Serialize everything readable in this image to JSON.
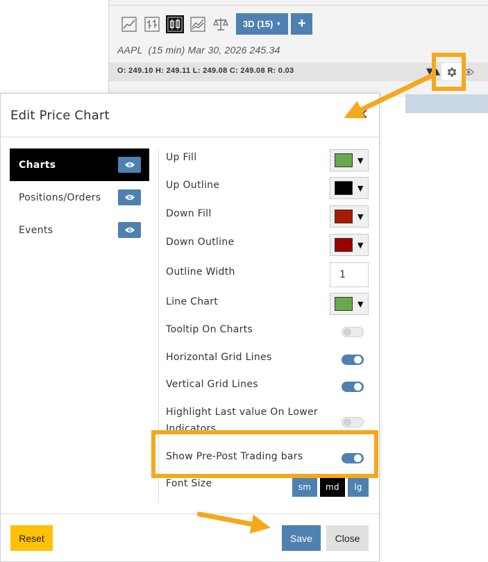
{
  "toolbar": {
    "icons": [
      "line-chart-icon",
      "ohlc-bars-icon",
      "candlestick-icon",
      "comparison-chart-icon",
      "balance-scale-icon"
    ],
    "timeframe_label": "3D (15)",
    "add_label": "+"
  },
  "chart_info": {
    "symbol_line": "AAPL  (15 min) Mar 30, 2026 245.34",
    "ohlc_line": "O: 249.10 H: 249.11 L: 249.08 C: 249.08 R: 0.03"
  },
  "dialog": {
    "title": "Edit Price Chart",
    "close_symbol": "✕",
    "sidebar": [
      {
        "label": "Charts",
        "active": true
      },
      {
        "label": "Positions/Orders",
        "active": false
      },
      {
        "label": "Events",
        "active": false
      }
    ],
    "settings": {
      "up_fill": {
        "label": "Up Fill",
        "color": "#6aa84f"
      },
      "up_outline": {
        "label": "Up Outline",
        "color": "#000000"
      },
      "down_fill": {
        "label": "Down Fill",
        "color": "#a61c00"
      },
      "down_outline": {
        "label": "Down Outline",
        "color": "#990000"
      },
      "outline_width": {
        "label": "Outline Width",
        "value": "1"
      },
      "line_chart": {
        "label": "Line Chart",
        "color": "#6aa84f"
      },
      "tooltip_on_charts": {
        "label": "Tooltip On Charts",
        "enabled": false
      },
      "horizontal_grid_lines": {
        "label": "Horizontal Grid Lines",
        "enabled": true
      },
      "vertical_grid_lines": {
        "label": "Vertical Grid Lines",
        "enabled": true
      },
      "highlight_last_value": {
        "label": "Highlight Last value On Lower Indicators",
        "enabled": false
      },
      "show_pre_post": {
        "label": "Show Pre-Post Trading bars",
        "enabled": true
      },
      "font_size": {
        "label": "Font Size",
        "options": [
          "sm",
          "md",
          "lg"
        ],
        "selected": "md"
      }
    },
    "footer": {
      "reset_label": "Reset",
      "save_label": "Save",
      "close_label": "Close"
    }
  },
  "colors": {
    "accent_blue": "#4f81b0",
    "highlight_orange": "#f5a81c",
    "reset_yellow": "#ffc107"
  }
}
